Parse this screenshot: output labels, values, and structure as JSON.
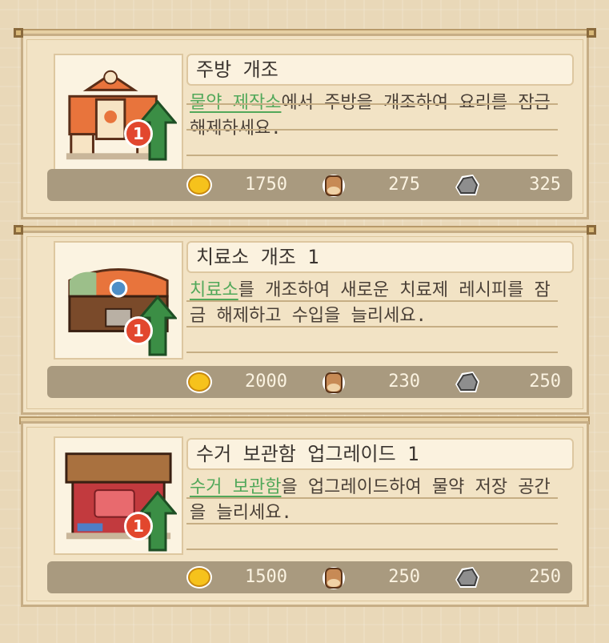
{
  "colors": {
    "accent_green": "#52a85a",
    "cost_bar": "#a99a7f",
    "badge_red": "#e2472e"
  },
  "upgrades": [
    {
      "title": "주방 개조",
      "desc_highlight": "물약 제작소",
      "desc_rest": "에서 주방을 개조하여 요리를 잠금 해제하세요.",
      "level_badge": "1",
      "icon": "kitchen-building-icon",
      "costs": {
        "gold": "1750",
        "wood": "275",
        "stone": "325"
      }
    },
    {
      "title": "치료소 개조 1",
      "desc_highlight": "치료소",
      "desc_rest": "를 개조하여 새로운 치료제 레시피를 잠금 해제하고 수입을 늘리세요.",
      "level_badge": "1",
      "icon": "clinic-chest-icon",
      "costs": {
        "gold": "2000",
        "wood": "230",
        "stone": "250"
      }
    },
    {
      "title": "수거 보관함 업그레이드 1",
      "desc_highlight": "수거 보관함",
      "desc_rest": "을 업그레이드하여 물약 저장 공간을 늘리세요.",
      "level_badge": "1",
      "icon": "collection-box-icon",
      "costs": {
        "gold": "1500",
        "wood": "250",
        "stone": "250"
      }
    }
  ]
}
